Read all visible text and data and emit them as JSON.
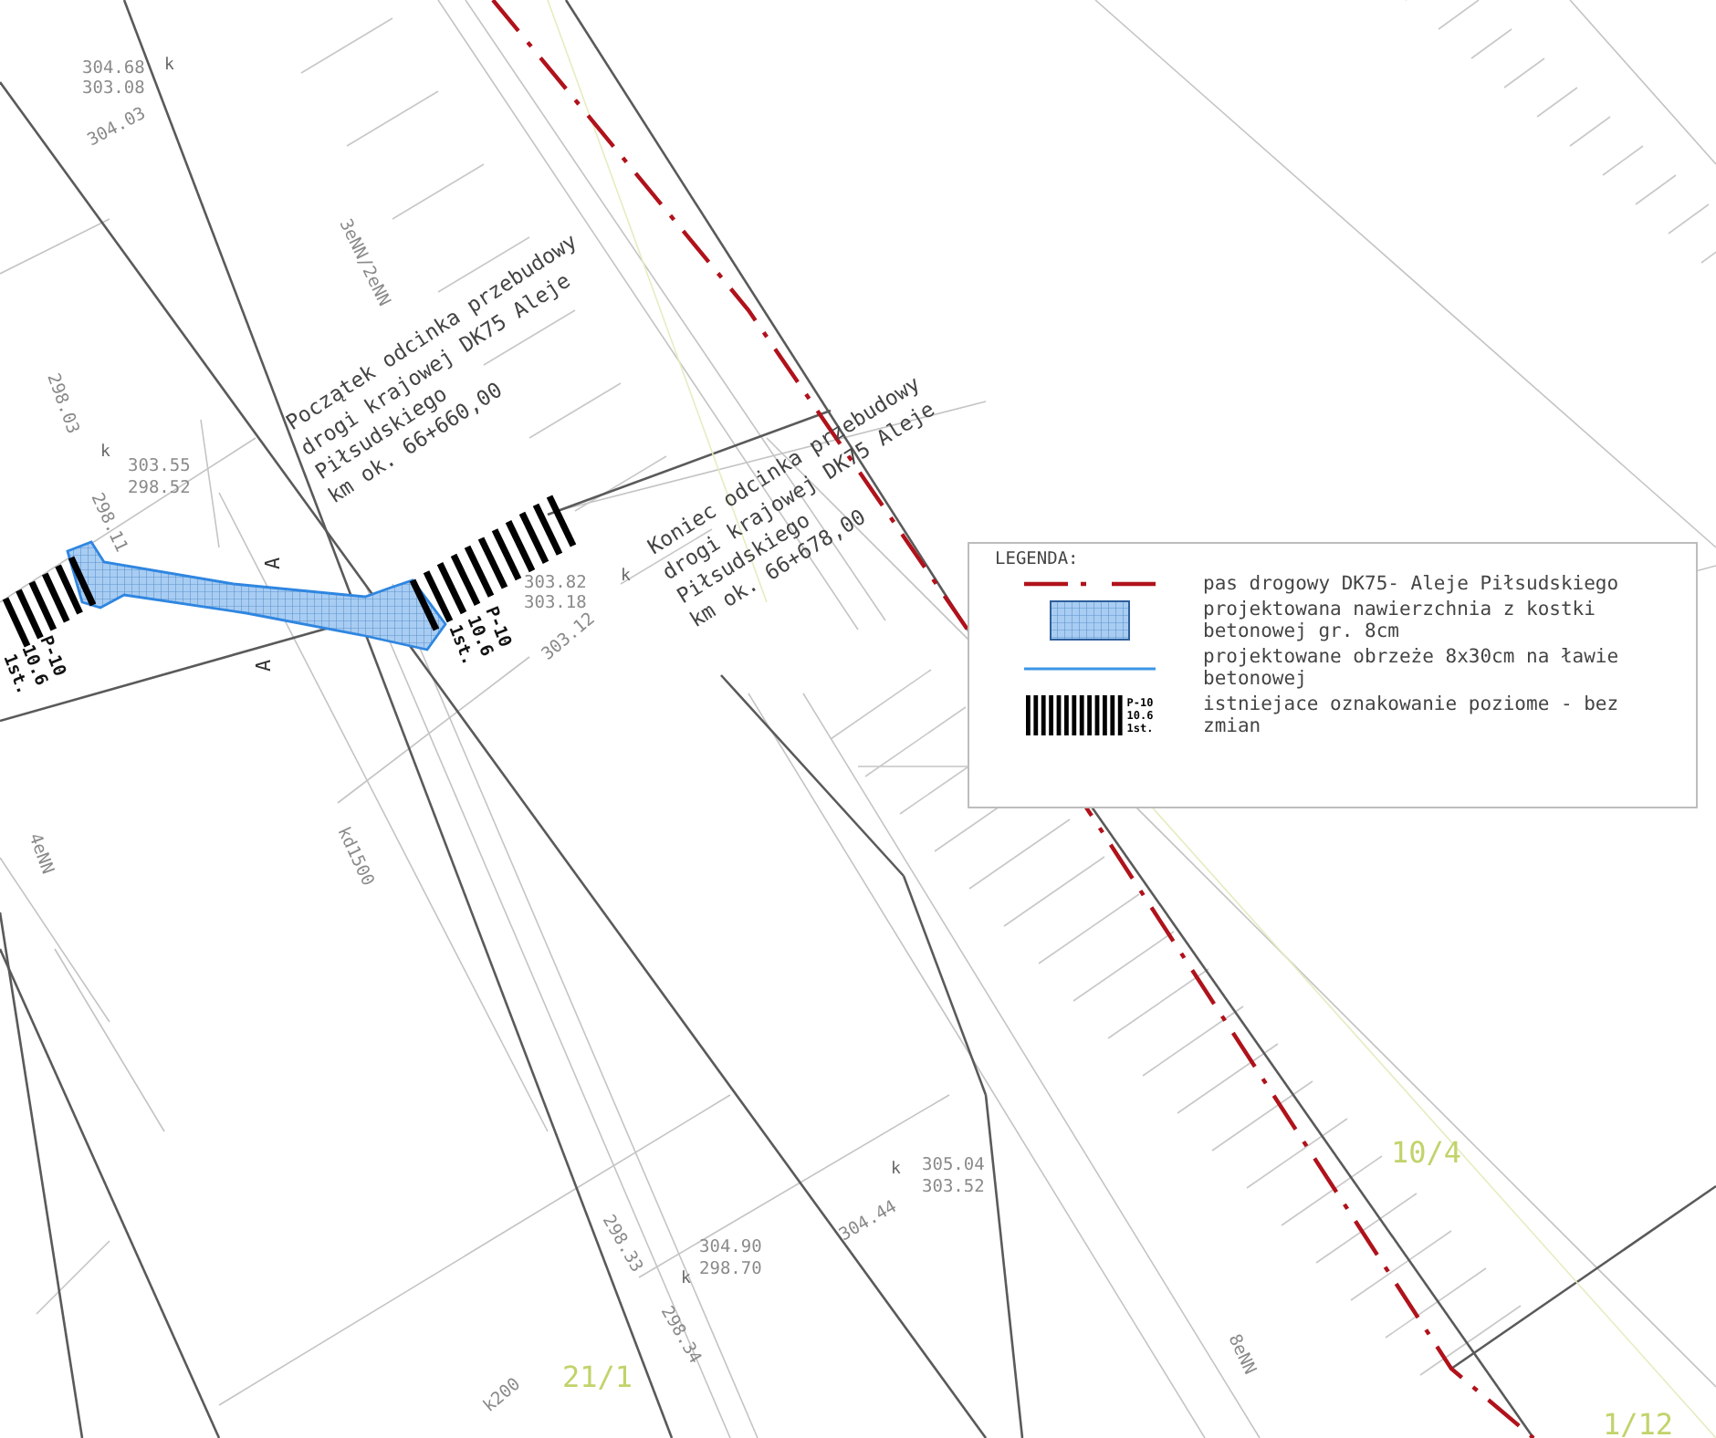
{
  "labels": [
    {
      "kind": "elevation",
      "text": "304.68"
    },
    {
      "kind": "elevation",
      "text": "303.08"
    },
    {
      "kind": "point",
      "text": "k"
    },
    {
      "kind": "elevation",
      "text": "304.03"
    },
    {
      "kind": "utility",
      "text": "3eNN/2eNN"
    },
    {
      "kind": "note",
      "text": "Początek odcinka przebudowy"
    },
    {
      "kind": "note",
      "text": "drogi krajowej DK75 Aleje"
    },
    {
      "kind": "note",
      "text": "Piłsudskiego"
    },
    {
      "kind": "note",
      "text": "km ok. 66+660,00"
    },
    {
      "kind": "elevation",
      "text": "303.55"
    },
    {
      "kind": "elevation",
      "text": "298.52"
    },
    {
      "kind": "point",
      "text": "k"
    },
    {
      "kind": "elevation",
      "text": "298.03"
    },
    {
      "kind": "elevation",
      "text": "298.11"
    },
    {
      "kind": "section",
      "text": "A"
    },
    {
      "kind": "section",
      "text": "A"
    },
    {
      "kind": "marking",
      "text": "P-10"
    },
    {
      "kind": "marking",
      "text": "10.6"
    },
    {
      "kind": "marking",
      "text": "1st."
    },
    {
      "kind": "marking",
      "text": "P-10"
    },
    {
      "kind": "marking",
      "text": "10.6"
    },
    {
      "kind": "marking",
      "text": "1st."
    },
    {
      "kind": "elevation",
      "text": "303.82"
    },
    {
      "kind": "elevation",
      "text": "303.18"
    },
    {
      "kind": "elevation",
      "text": "303.12"
    },
    {
      "kind": "point",
      "text": "k"
    },
    {
      "kind": "note",
      "text": "Koniec odcinka przebudowy"
    },
    {
      "kind": "note",
      "text": "drogi krajowej DK75 Aleje"
    },
    {
      "kind": "note",
      "text": "Piłsudskiego"
    },
    {
      "kind": "note",
      "text": "km ok. 66+678,00"
    },
    {
      "kind": "utility",
      "text": "kd1500"
    },
    {
      "kind": "utility",
      "text": "4eNN"
    },
    {
      "kind": "elevation",
      "text": "298.33"
    },
    {
      "kind": "elevation",
      "text": "304.90"
    },
    {
      "kind": "elevation",
      "text": "298.70"
    },
    {
      "kind": "point",
      "text": "k"
    },
    {
      "kind": "elevation",
      "text": "298.34"
    },
    {
      "kind": "elevation",
      "text": "304.44"
    },
    {
      "kind": "elevation",
      "text": "305.04"
    },
    {
      "kind": "elevation",
      "text": "303.52"
    },
    {
      "kind": "point",
      "text": "k"
    },
    {
      "kind": "utility",
      "text": "k200"
    },
    {
      "kind": "parcel",
      "text": "21/1"
    },
    {
      "kind": "parcel",
      "text": "10/4"
    },
    {
      "kind": "parcel",
      "text": "1/12"
    },
    {
      "kind": "utility",
      "text": "8eNN"
    }
  ],
  "legend": {
    "title": "LEGENDA:",
    "items": [
      {
        "kind": "road-boundary",
        "text": "pas drogowy DK75- Aleje Piłsudskiego"
      },
      {
        "kind": "paving",
        "text": "projektowana nawierzchnia z kostki betonowej gr. 8cm"
      },
      {
        "kind": "curb",
        "text": "projektowane obrzeże 8x30cm na ławie betonowej"
      },
      {
        "kind": "marking",
        "text": "istniejace oznakowanie poziome - bez zmian",
        "marks": [
          "P-10",
          "10.6",
          "1st."
        ]
      }
    ]
  }
}
